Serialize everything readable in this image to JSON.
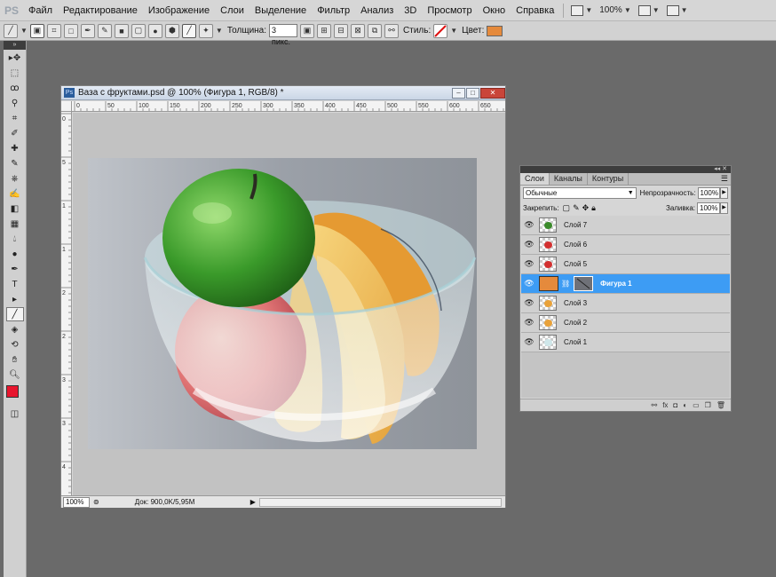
{
  "app": {
    "logo": "PS"
  },
  "menu": {
    "items": [
      "Файл",
      "Редактирование",
      "Изображение",
      "Слои",
      "Выделение",
      "Фильтр",
      "Анализ",
      "3D",
      "Просмотр",
      "Окно",
      "Справка"
    ],
    "zoom": "100%"
  },
  "options": {
    "thickness_label": "Толщина:",
    "thickness_value": "3 пикс.",
    "styles_label": "Стиль:",
    "color_label": "Цвет:",
    "color_value": "#e58a3c"
  },
  "document": {
    "title": "Ваза с фруктами.psd @ 100% (Фигура 1, RGB/8) *",
    "ruler_h": [
      "0",
      "50",
      "100",
      "150",
      "200",
      "250",
      "300",
      "350",
      "400",
      "450",
      "500",
      "550",
      "600",
      "650"
    ],
    "ruler_v": [
      "0",
      "5",
      "1",
      "1",
      "2",
      "2",
      "3",
      "3",
      "4"
    ],
    "zoom": "100%",
    "info": "Док: 900,0K/5,95M"
  },
  "tools": {
    "foreground_color": "#e8162e",
    "icons": [
      "move-icon",
      "marquee-icon",
      "lasso-icon",
      "quick-select-icon",
      "crop-icon",
      "eyedropper-icon",
      "healing-icon",
      "brush-icon",
      "stamp-icon",
      "history-brush-icon",
      "eraser-icon",
      "gradient-icon",
      "blur-icon",
      "dodge-icon",
      "pen-icon",
      "type-icon",
      "path-select-icon",
      "line-icon",
      "3d-rotate-icon",
      "3d-orbit-icon",
      "hand-icon",
      "zoom-icon"
    ]
  },
  "layers_panel": {
    "tabs": [
      "Слои",
      "Каналы",
      "Контуры"
    ],
    "blend_mode": "Обычные",
    "opacity_label": "Непрозрачность:",
    "opacity_value": "100%",
    "lock_label": "Закрепить:",
    "fill_label": "Заливка:",
    "fill_value": "100%",
    "layers": [
      {
        "name": "Слой 7",
        "thumb_color": "#3a8a2a",
        "active": false,
        "shape": false
      },
      {
        "name": "Слой 6",
        "thumb_color": "#d33030",
        "active": false,
        "shape": false
      },
      {
        "name": "Слой 5",
        "thumb_color": "#d33030",
        "active": false,
        "shape": false
      },
      {
        "name": "Фигура 1",
        "thumb_color": "#e58a3c",
        "active": true,
        "shape": true
      },
      {
        "name": "Слой 3",
        "thumb_color": "#e9a23a",
        "active": false,
        "shape": false
      },
      {
        "name": "Слой 2",
        "thumb_color": "#e9a23a",
        "active": false,
        "shape": false
      },
      {
        "name": "Слой 1",
        "thumb_color": "#cfe7ea",
        "active": false,
        "shape": false
      }
    ]
  }
}
